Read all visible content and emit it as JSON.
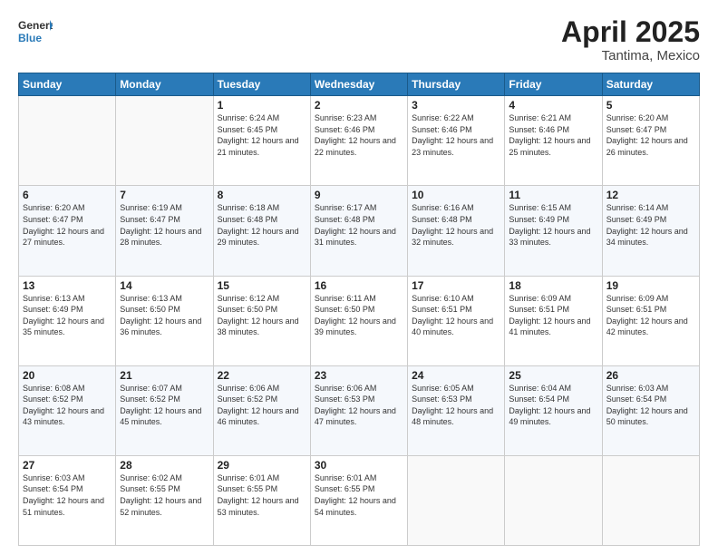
{
  "header": {
    "logo_line1": "General",
    "logo_line2": "Blue",
    "title": "April 2025",
    "subtitle": "Tantima, Mexico"
  },
  "weekdays": [
    "Sunday",
    "Monday",
    "Tuesday",
    "Wednesday",
    "Thursday",
    "Friday",
    "Saturday"
  ],
  "weeks": [
    [
      {
        "day": "",
        "info": ""
      },
      {
        "day": "",
        "info": ""
      },
      {
        "day": "1",
        "info": "Sunrise: 6:24 AM\nSunset: 6:45 PM\nDaylight: 12 hours and 21 minutes."
      },
      {
        "day": "2",
        "info": "Sunrise: 6:23 AM\nSunset: 6:46 PM\nDaylight: 12 hours and 22 minutes."
      },
      {
        "day": "3",
        "info": "Sunrise: 6:22 AM\nSunset: 6:46 PM\nDaylight: 12 hours and 23 minutes."
      },
      {
        "day": "4",
        "info": "Sunrise: 6:21 AM\nSunset: 6:46 PM\nDaylight: 12 hours and 25 minutes."
      },
      {
        "day": "5",
        "info": "Sunrise: 6:20 AM\nSunset: 6:47 PM\nDaylight: 12 hours and 26 minutes."
      }
    ],
    [
      {
        "day": "6",
        "info": "Sunrise: 6:20 AM\nSunset: 6:47 PM\nDaylight: 12 hours and 27 minutes."
      },
      {
        "day": "7",
        "info": "Sunrise: 6:19 AM\nSunset: 6:47 PM\nDaylight: 12 hours and 28 minutes."
      },
      {
        "day": "8",
        "info": "Sunrise: 6:18 AM\nSunset: 6:48 PM\nDaylight: 12 hours and 29 minutes."
      },
      {
        "day": "9",
        "info": "Sunrise: 6:17 AM\nSunset: 6:48 PM\nDaylight: 12 hours and 31 minutes."
      },
      {
        "day": "10",
        "info": "Sunrise: 6:16 AM\nSunset: 6:48 PM\nDaylight: 12 hours and 32 minutes."
      },
      {
        "day": "11",
        "info": "Sunrise: 6:15 AM\nSunset: 6:49 PM\nDaylight: 12 hours and 33 minutes."
      },
      {
        "day": "12",
        "info": "Sunrise: 6:14 AM\nSunset: 6:49 PM\nDaylight: 12 hours and 34 minutes."
      }
    ],
    [
      {
        "day": "13",
        "info": "Sunrise: 6:13 AM\nSunset: 6:49 PM\nDaylight: 12 hours and 35 minutes."
      },
      {
        "day": "14",
        "info": "Sunrise: 6:13 AM\nSunset: 6:50 PM\nDaylight: 12 hours and 36 minutes."
      },
      {
        "day": "15",
        "info": "Sunrise: 6:12 AM\nSunset: 6:50 PM\nDaylight: 12 hours and 38 minutes."
      },
      {
        "day": "16",
        "info": "Sunrise: 6:11 AM\nSunset: 6:50 PM\nDaylight: 12 hours and 39 minutes."
      },
      {
        "day": "17",
        "info": "Sunrise: 6:10 AM\nSunset: 6:51 PM\nDaylight: 12 hours and 40 minutes."
      },
      {
        "day": "18",
        "info": "Sunrise: 6:09 AM\nSunset: 6:51 PM\nDaylight: 12 hours and 41 minutes."
      },
      {
        "day": "19",
        "info": "Sunrise: 6:09 AM\nSunset: 6:51 PM\nDaylight: 12 hours and 42 minutes."
      }
    ],
    [
      {
        "day": "20",
        "info": "Sunrise: 6:08 AM\nSunset: 6:52 PM\nDaylight: 12 hours and 43 minutes."
      },
      {
        "day": "21",
        "info": "Sunrise: 6:07 AM\nSunset: 6:52 PM\nDaylight: 12 hours and 45 minutes."
      },
      {
        "day": "22",
        "info": "Sunrise: 6:06 AM\nSunset: 6:52 PM\nDaylight: 12 hours and 46 minutes."
      },
      {
        "day": "23",
        "info": "Sunrise: 6:06 AM\nSunset: 6:53 PM\nDaylight: 12 hours and 47 minutes."
      },
      {
        "day": "24",
        "info": "Sunrise: 6:05 AM\nSunset: 6:53 PM\nDaylight: 12 hours and 48 minutes."
      },
      {
        "day": "25",
        "info": "Sunrise: 6:04 AM\nSunset: 6:54 PM\nDaylight: 12 hours and 49 minutes."
      },
      {
        "day": "26",
        "info": "Sunrise: 6:03 AM\nSunset: 6:54 PM\nDaylight: 12 hours and 50 minutes."
      }
    ],
    [
      {
        "day": "27",
        "info": "Sunrise: 6:03 AM\nSunset: 6:54 PM\nDaylight: 12 hours and 51 minutes."
      },
      {
        "day": "28",
        "info": "Sunrise: 6:02 AM\nSunset: 6:55 PM\nDaylight: 12 hours and 52 minutes."
      },
      {
        "day": "29",
        "info": "Sunrise: 6:01 AM\nSunset: 6:55 PM\nDaylight: 12 hours and 53 minutes."
      },
      {
        "day": "30",
        "info": "Sunrise: 6:01 AM\nSunset: 6:55 PM\nDaylight: 12 hours and 54 minutes."
      },
      {
        "day": "",
        "info": ""
      },
      {
        "day": "",
        "info": ""
      },
      {
        "day": "",
        "info": ""
      }
    ]
  ]
}
